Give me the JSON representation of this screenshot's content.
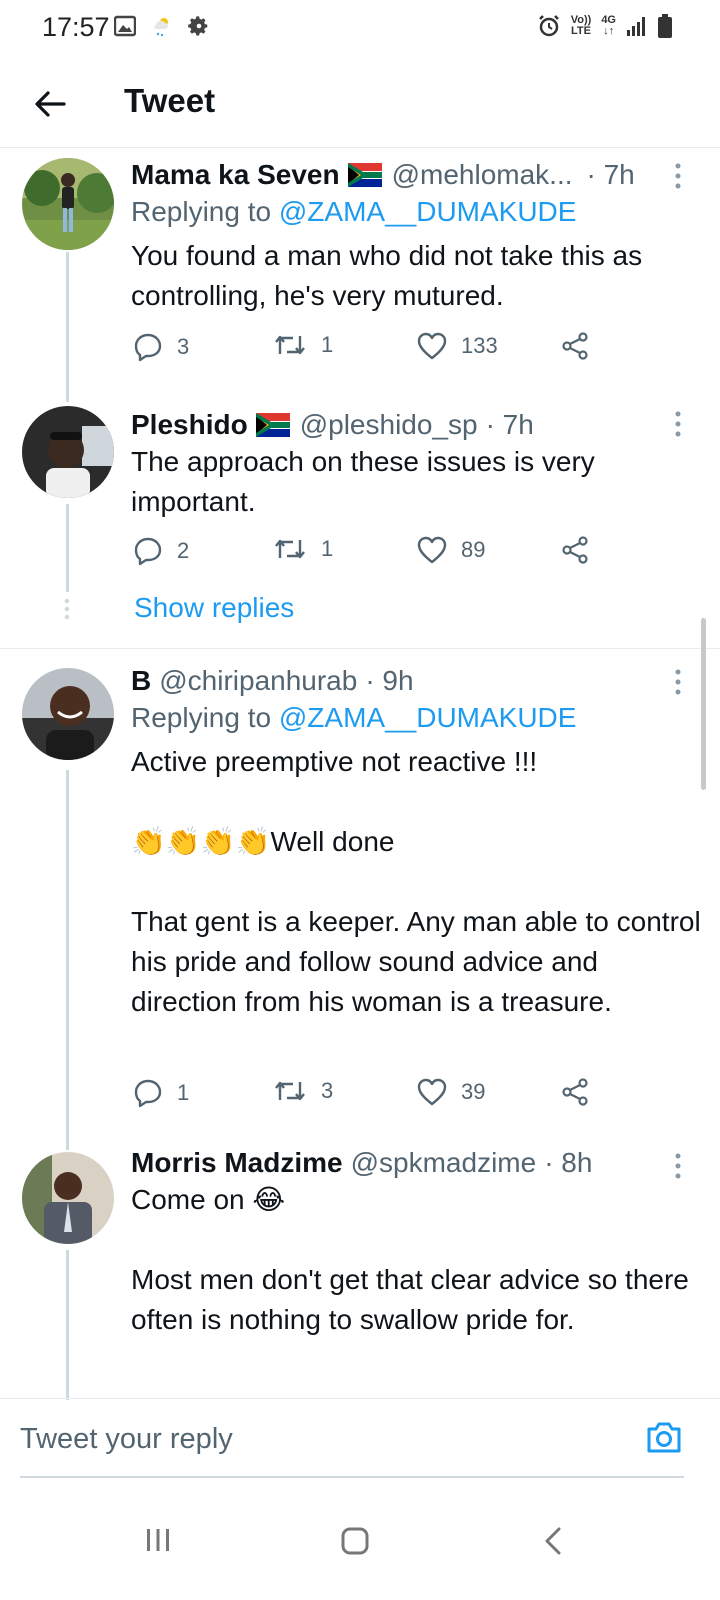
{
  "status_bar": {
    "time": "17:57",
    "lte_top": "Vo))",
    "lte_bottom": "LTE",
    "network": "4G"
  },
  "header": {
    "title": "Tweet"
  },
  "tweets": [
    {
      "name": "Mama ka Seven",
      "handle": "@mehlomak...",
      "time": "· 7h",
      "replying_prefix": "Replying to ",
      "replying_to": "@ZAMA__DUMAKUDE",
      "text": "You found a man who did not take this as controlling, he's very mutured.",
      "replies": "3",
      "retweets": "1",
      "likes": "133"
    },
    {
      "name": "Pleshido",
      "handle": "@pleshido_sp",
      "time": "· 7h",
      "text": "The approach on these issues is very important.",
      "replies": "2",
      "retweets": "1",
      "likes": "89"
    },
    {
      "name": "B",
      "handle": "@chiripanhurab",
      "time": "· 9h",
      "replying_prefix": "Replying to ",
      "replying_to": "@ZAMA__DUMAKUDE",
      "text_1": "Active preemptive not reactive !!!",
      "emoji": "👏👏👏👏",
      "text_2": "Well done",
      "text_3": "That gent is a keeper. Any man able to control his pride and follow sound advice and direction from his woman is a treasure.",
      "replies": "1",
      "retweets": "3",
      "likes": "39"
    },
    {
      "name": "Morris Madzime",
      "handle": "@spkmadzime",
      "time": "· 8h",
      "text_1": "Come on",
      "emoji": "😂",
      "text_2": "Most men don't get that clear advice so there often is nothing to swallow pride for."
    }
  ],
  "show_replies": "Show replies",
  "composer": {
    "placeholder": "Tweet your reply"
  },
  "colors": {
    "accent": "#1d9bf0",
    "text_primary": "#0f1419",
    "text_secondary": "#536471",
    "divider": "#e6ecf0"
  },
  "icons": [
    "back-arrow-icon",
    "reply-icon",
    "retweet-icon",
    "like-icon",
    "share-icon",
    "more-icon",
    "camera-icon",
    "image-icon",
    "weather-icon",
    "gear-icon",
    "alarm-icon",
    "signal-icon",
    "battery-icon",
    "south-africa-flag-icon"
  ]
}
